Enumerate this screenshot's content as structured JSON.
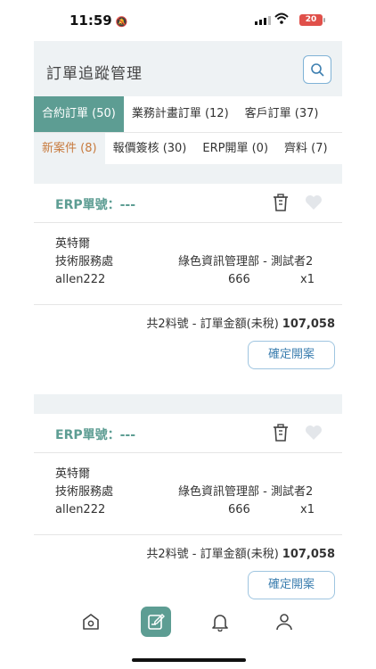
{
  "status_bar": {
    "time": "11:59",
    "battery": "20"
  },
  "header": {
    "title": "訂單追蹤管理"
  },
  "tabs_primary": [
    {
      "label": "合約訂單 (50)"
    },
    {
      "label": "業務計畫訂單 (12)"
    },
    {
      "label": "客戶訂單 (37)"
    }
  ],
  "tabs_secondary": [
    {
      "label": "新案件 (8)"
    },
    {
      "label": "報價簽核 (30)"
    },
    {
      "label": "ERP開單 (0)"
    },
    {
      "label": "齊料 (7)"
    }
  ],
  "orders": [
    {
      "erp_label": "ERP單號：---",
      "company": "英特爾",
      "division": "技術服務處",
      "department": "綠色資訊管理部 - 測試者2",
      "user": "allen222",
      "number": "666",
      "quantity": "x1",
      "summary_text": "共2料號 - 訂單金額(未稅)",
      "amount": "107,058",
      "confirm_label": "確定開案"
    },
    {
      "erp_label": "ERP單號：---",
      "company": "英特爾",
      "division": "技術服務處",
      "department": "綠色資訊管理部 - 測試者2",
      "user": "allen222",
      "number": "666",
      "quantity": "x1",
      "summary_text": "共2料號 - 訂單金額(未稅)",
      "amount": "107,058",
      "confirm_label": "確定開案"
    }
  ],
  "bottom_nav": [
    {
      "icon": "home-icon"
    },
    {
      "icon": "edit-icon",
      "active": true
    },
    {
      "icon": "bell-icon"
    },
    {
      "icon": "user-icon"
    }
  ],
  "colors": {
    "accent": "#5d9d93",
    "tab_active_secondary": "#c77a3d",
    "battery": "#e0504a"
  }
}
